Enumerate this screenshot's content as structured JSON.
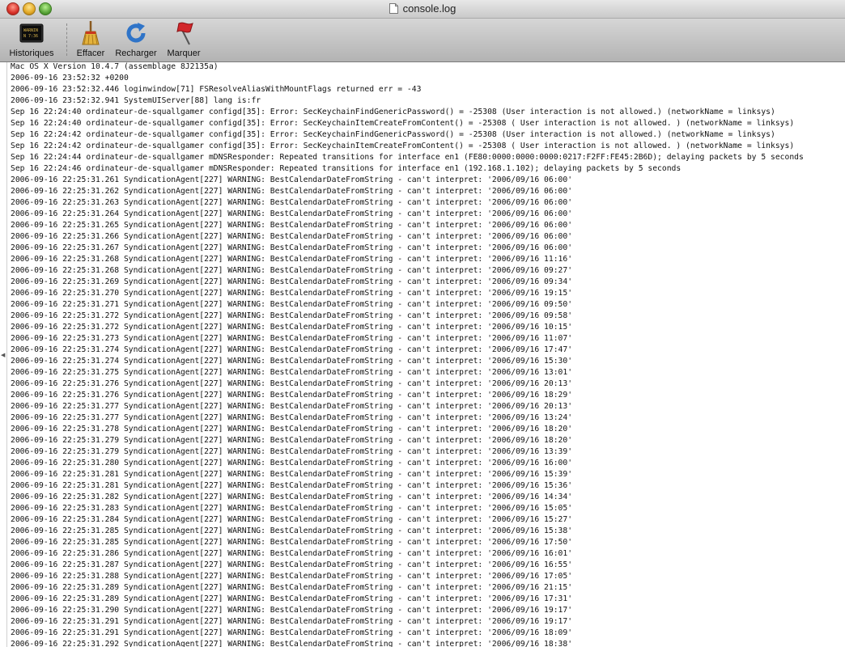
{
  "window": {
    "title": "console.log"
  },
  "toolbar": {
    "items": [
      {
        "label": "Historiques",
        "icon": "console-log-icon"
      },
      {
        "label": "Effacer",
        "icon": "broom-icon"
      },
      {
        "label": "Recharger",
        "icon": "reload-icon"
      },
      {
        "label": "Marquer",
        "icon": "marker-flag-icon"
      }
    ],
    "log_icon_text": "WARNIN\nN 7:36"
  },
  "log": {
    "lines": [
      "Mac OS X Version 10.4.7 (assemblage 8J2135a)",
      "2006-09-16 23:52:32 +0200",
      "2006-09-16 23:52:32.446 loginwindow[71] FSResolveAliasWithMountFlags returned err = -43",
      "2006-09-16 23:52:32.941 SystemUIServer[88] lang is:fr",
      "Sep 16 22:24:40 ordinateur-de-squallgamer configd[35]: Error: SecKeychainFindGenericPassword() = -25308 (User interaction is not allowed.) (networkName = linksys)",
      "Sep 16 22:24:40 ordinateur-de-squallgamer configd[35]: Error: SecKeychainItemCreateFromContent() = -25308 ( User interaction is not allowed. ) (networkName = linksys)",
      "Sep 16 22:24:42 ordinateur-de-squallgamer configd[35]: Error: SecKeychainFindGenericPassword() = -25308 (User interaction is not allowed.) (networkName = linksys)",
      "Sep 16 22:24:42 ordinateur-de-squallgamer configd[35]: Error: SecKeychainItemCreateFromContent() = -25308 ( User interaction is not allowed. ) (networkName = linksys)",
      "Sep 16 22:24:44 ordinateur-de-squallgamer mDNSResponder: Repeated transitions for interface en1 (FE80:0000:0000:0000:0217:F2FF:FE45:2B6D); delaying packets by 5 seconds",
      "Sep 16 22:24:46 ordinateur-de-squallgamer mDNSResponder: Repeated transitions for interface en1 (192.168.1.102); delaying packets by 5 seconds",
      "2006-09-16 22:25:31.261 SyndicationAgent[227] WARNING: BestCalendarDateFromString - can't interpret: '2006/09/16 06:00'",
      "2006-09-16 22:25:31.262 SyndicationAgent[227] WARNING: BestCalendarDateFromString - can't interpret: '2006/09/16 06:00'",
      "2006-09-16 22:25:31.263 SyndicationAgent[227] WARNING: BestCalendarDateFromString - can't interpret: '2006/09/16 06:00'",
      "2006-09-16 22:25:31.264 SyndicationAgent[227] WARNING: BestCalendarDateFromString - can't interpret: '2006/09/16 06:00'",
      "2006-09-16 22:25:31.265 SyndicationAgent[227] WARNING: BestCalendarDateFromString - can't interpret: '2006/09/16 06:00'",
      "2006-09-16 22:25:31.266 SyndicationAgent[227] WARNING: BestCalendarDateFromString - can't interpret: '2006/09/16 06:00'",
      "2006-09-16 22:25:31.267 SyndicationAgent[227] WARNING: BestCalendarDateFromString - can't interpret: '2006/09/16 06:00'",
      "2006-09-16 22:25:31.268 SyndicationAgent[227] WARNING: BestCalendarDateFromString - can't interpret: '2006/09/16 11:16'",
      "2006-09-16 22:25:31.268 SyndicationAgent[227] WARNING: BestCalendarDateFromString - can't interpret: '2006/09/16 09:27'",
      "2006-09-16 22:25:31.269 SyndicationAgent[227] WARNING: BestCalendarDateFromString - can't interpret: '2006/09/16 09:34'",
      "2006-09-16 22:25:31.270 SyndicationAgent[227] WARNING: BestCalendarDateFromString - can't interpret: '2006/09/16 19:15'",
      "2006-09-16 22:25:31.271 SyndicationAgent[227] WARNING: BestCalendarDateFromString - can't interpret: '2006/09/16 09:50'",
      "2006-09-16 22:25:31.272 SyndicationAgent[227] WARNING: BestCalendarDateFromString - can't interpret: '2006/09/16 09:58'",
      "2006-09-16 22:25:31.272 SyndicationAgent[227] WARNING: BestCalendarDateFromString - can't interpret: '2006/09/16 10:15'",
      "2006-09-16 22:25:31.273 SyndicationAgent[227] WARNING: BestCalendarDateFromString - can't interpret: '2006/09/16 11:07'",
      "2006-09-16 22:25:31.274 SyndicationAgent[227] WARNING: BestCalendarDateFromString - can't interpret: '2006/09/16 17:47'",
      "2006-09-16 22:25:31.274 SyndicationAgent[227] WARNING: BestCalendarDateFromString - can't interpret: '2006/09/16 15:30'",
      "2006-09-16 22:25:31.275 SyndicationAgent[227] WARNING: BestCalendarDateFromString - can't interpret: '2006/09/16 13:01'",
      "2006-09-16 22:25:31.276 SyndicationAgent[227] WARNING: BestCalendarDateFromString - can't interpret: '2006/09/16 20:13'",
      "2006-09-16 22:25:31.276 SyndicationAgent[227] WARNING: BestCalendarDateFromString - can't interpret: '2006/09/16 18:29'",
      "2006-09-16 22:25:31.277 SyndicationAgent[227] WARNING: BestCalendarDateFromString - can't interpret: '2006/09/16 20:13'",
      "2006-09-16 22:25:31.277 SyndicationAgent[227] WARNING: BestCalendarDateFromString - can't interpret: '2006/09/16 13:24'",
      "2006-09-16 22:25:31.278 SyndicationAgent[227] WARNING: BestCalendarDateFromString - can't interpret: '2006/09/16 18:20'",
      "2006-09-16 22:25:31.279 SyndicationAgent[227] WARNING: BestCalendarDateFromString - can't interpret: '2006/09/16 18:20'",
      "2006-09-16 22:25:31.279 SyndicationAgent[227] WARNING: BestCalendarDateFromString - can't interpret: '2006/09/16 13:39'",
      "2006-09-16 22:25:31.280 SyndicationAgent[227] WARNING: BestCalendarDateFromString - can't interpret: '2006/09/16 16:00'",
      "2006-09-16 22:25:31.281 SyndicationAgent[227] WARNING: BestCalendarDateFromString - can't interpret: '2006/09/16 15:39'",
      "2006-09-16 22:25:31.281 SyndicationAgent[227] WARNING: BestCalendarDateFromString - can't interpret: '2006/09/16 15:36'",
      "2006-09-16 22:25:31.282 SyndicationAgent[227] WARNING: BestCalendarDateFromString - can't interpret: '2006/09/16 14:34'",
      "2006-09-16 22:25:31.283 SyndicationAgent[227] WARNING: BestCalendarDateFromString - can't interpret: '2006/09/16 15:05'",
      "2006-09-16 22:25:31.284 SyndicationAgent[227] WARNING: BestCalendarDateFromString - can't interpret: '2006/09/16 15:27'",
      "2006-09-16 22:25:31.285 SyndicationAgent[227] WARNING: BestCalendarDateFromString - can't interpret: '2006/09/16 15:38'",
      "2006-09-16 22:25:31.285 SyndicationAgent[227] WARNING: BestCalendarDateFromString - can't interpret: '2006/09/16 17:50'",
      "2006-09-16 22:25:31.286 SyndicationAgent[227] WARNING: BestCalendarDateFromString - can't interpret: '2006/09/16 16:01'",
      "2006-09-16 22:25:31.287 SyndicationAgent[227] WARNING: BestCalendarDateFromString - can't interpret: '2006/09/16 16:55'",
      "2006-09-16 22:25:31.288 SyndicationAgent[227] WARNING: BestCalendarDateFromString - can't interpret: '2006/09/16 17:05'",
      "2006-09-16 22:25:31.289 SyndicationAgent[227] WARNING: BestCalendarDateFromString - can't interpret: '2006/09/16 21:15'",
      "2006-09-16 22:25:31.289 SyndicationAgent[227] WARNING: BestCalendarDateFromString - can't interpret: '2006/09/16 17:31'",
      "2006-09-16 22:25:31.290 SyndicationAgent[227] WARNING: BestCalendarDateFromString - can't interpret: '2006/09/16 19:17'",
      "2006-09-16 22:25:31.291 SyndicationAgent[227] WARNING: BestCalendarDateFromString - can't interpret: '2006/09/16 19:17'",
      "2006-09-16 22:25:31.291 SyndicationAgent[227] WARNING: BestCalendarDateFromString - can't interpret: '2006/09/16 18:09'",
      "2006-09-16 22:25:31.292 SyndicationAgent[227] WARNING: BestCalendarDateFromString - can't interpret: '2006/09/16 18:38'"
    ]
  }
}
